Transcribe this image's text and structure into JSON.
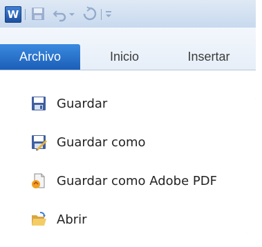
{
  "app": {
    "icon_letter": "W",
    "brand_color": "#1d5fb8"
  },
  "quick_access": {
    "icons": [
      "save-icon",
      "undo-icon",
      "dropdown-arrow-icon",
      "redo-icon",
      "customize-qat-icon"
    ]
  },
  "tabs": [
    {
      "label": "Archivo",
      "active": true
    },
    {
      "label": "Inicio",
      "active": false
    },
    {
      "label": "Insertar",
      "active": false
    }
  ],
  "menu": {
    "items": [
      {
        "label": "Guardar",
        "icon": "save-icon"
      },
      {
        "label": "Guardar como",
        "icon": "save-as-icon"
      },
      {
        "label": "Guardar como Adobe PDF",
        "icon": "pdf-icon"
      },
      {
        "label": "Abrir",
        "icon": "open-folder-icon"
      }
    ]
  }
}
